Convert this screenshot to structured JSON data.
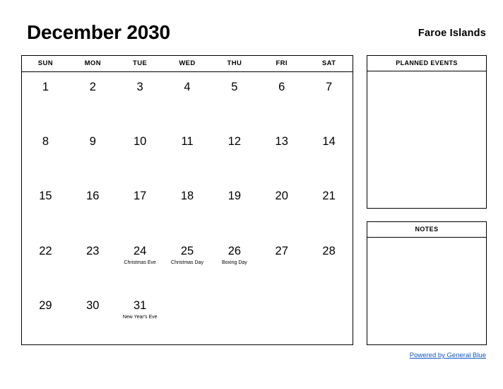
{
  "header": {
    "month_title": "December 2030",
    "country": "Faroe Islands"
  },
  "calendar": {
    "weekdays": [
      "SUN",
      "MON",
      "TUE",
      "WED",
      "THU",
      "FRI",
      "SAT"
    ],
    "weeks": [
      [
        {
          "day": "1",
          "holiday": ""
        },
        {
          "day": "2",
          "holiday": ""
        },
        {
          "day": "3",
          "holiday": ""
        },
        {
          "day": "4",
          "holiday": ""
        },
        {
          "day": "5",
          "holiday": ""
        },
        {
          "day": "6",
          "holiday": ""
        },
        {
          "day": "7",
          "holiday": ""
        }
      ],
      [
        {
          "day": "8",
          "holiday": ""
        },
        {
          "day": "9",
          "holiday": ""
        },
        {
          "day": "10",
          "holiday": ""
        },
        {
          "day": "11",
          "holiday": ""
        },
        {
          "day": "12",
          "holiday": ""
        },
        {
          "day": "13",
          "holiday": ""
        },
        {
          "day": "14",
          "holiday": ""
        }
      ],
      [
        {
          "day": "15",
          "holiday": ""
        },
        {
          "day": "16",
          "holiday": ""
        },
        {
          "day": "17",
          "holiday": ""
        },
        {
          "day": "18",
          "holiday": ""
        },
        {
          "day": "19",
          "holiday": ""
        },
        {
          "day": "20",
          "holiday": ""
        },
        {
          "day": "21",
          "holiday": ""
        }
      ],
      [
        {
          "day": "22",
          "holiday": ""
        },
        {
          "day": "23",
          "holiday": ""
        },
        {
          "day": "24",
          "holiday": "Christmas Eve"
        },
        {
          "day": "25",
          "holiday": "Christmas Day"
        },
        {
          "day": "26",
          "holiday": "Boxing Day"
        },
        {
          "day": "27",
          "holiday": ""
        },
        {
          "day": "28",
          "holiday": ""
        }
      ],
      [
        {
          "day": "29",
          "holiday": ""
        },
        {
          "day": "30",
          "holiday": ""
        },
        {
          "day": "31",
          "holiday": "New Year's Eve"
        },
        {
          "day": "",
          "holiday": ""
        },
        {
          "day": "",
          "holiday": ""
        },
        {
          "day": "",
          "holiday": ""
        },
        {
          "day": "",
          "holiday": ""
        }
      ]
    ]
  },
  "panels": {
    "planned_events_title": "PLANNED EVENTS",
    "notes_title": "NOTES"
  },
  "footer": {
    "link_text": "Powered by General Blue",
    "link_color": "#1155cc"
  }
}
